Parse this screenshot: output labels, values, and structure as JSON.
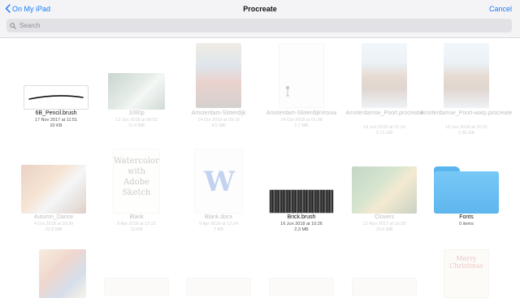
{
  "header": {
    "back_label": "On My iPad",
    "title": "Procreate",
    "cancel_label": "Cancel"
  },
  "search": {
    "placeholder": "Search"
  },
  "colors": {
    "accent": "#1a7cf5",
    "folder": "#5eb6ee"
  },
  "files": [
    {
      "name": "6B_Pencil.brush",
      "date": "17 Nov 2017 at 11:51",
      "size": "20 KB",
      "dimmed": false
    },
    {
      "name": "1080p",
      "date": "12 Jun 2018 at 09:53",
      "size": "11.4 MB",
      "dimmed": true
    },
    {
      "name": "Amsterdam-Sloterdijk",
      "date": "14 Oct 2018 at 09:19",
      "size": "4.5 MB",
      "dimmed": true
    },
    {
      "name": "Amsterdam-SloterdijkVrouw",
      "date": "14 Oct 2018 at 01:08",
      "size": "1.7 MB",
      "dimmed": true
    },
    {
      "name": "Amsterdamse_Poort.procreate",
      "date": "16 Jun 2018 at 21:13",
      "size": "2.71 GB",
      "dimmed": true
    },
    {
      "name": "Amsterdamse_Poort-warp.procreate",
      "date": "16 Jun 2018 at 22:10",
      "size": "2.56 GB",
      "dimmed": true
    },
    {
      "name": "Autumn_Dance",
      "date": "4 Oct 2018 at 10:30",
      "size": "22.5 MB",
      "dimmed": true
    },
    {
      "name": "Blank",
      "date": "9 Apr 2018 at 12:23",
      "size": "13 KB",
      "dimmed": true,
      "thumb_text": [
        "Watercolor",
        "with",
        "Adobe",
        "Sketch"
      ]
    },
    {
      "name": "Blank.docx",
      "date": "9 Apr 2018 at 12:24",
      "size": "7 KB",
      "dimmed": true,
      "thumb_text": [
        "W"
      ]
    },
    {
      "name": "Brick.brush",
      "date": "16 Jun 2018 at 10:26",
      "size": "2,3 MB",
      "dimmed": false
    },
    {
      "name": "Clovers",
      "date": "12 Nov 2017 at 16:28",
      "size": "15.6 MB",
      "dimmed": true
    },
    {
      "name": "Fonts",
      "date": "0 items",
      "size": "",
      "dimmed": false
    },
    {
      "name": "",
      "date": "",
      "size": "",
      "dimmed": true,
      "thumb_text": [
        "Merry",
        "Christmas"
      ]
    }
  ]
}
